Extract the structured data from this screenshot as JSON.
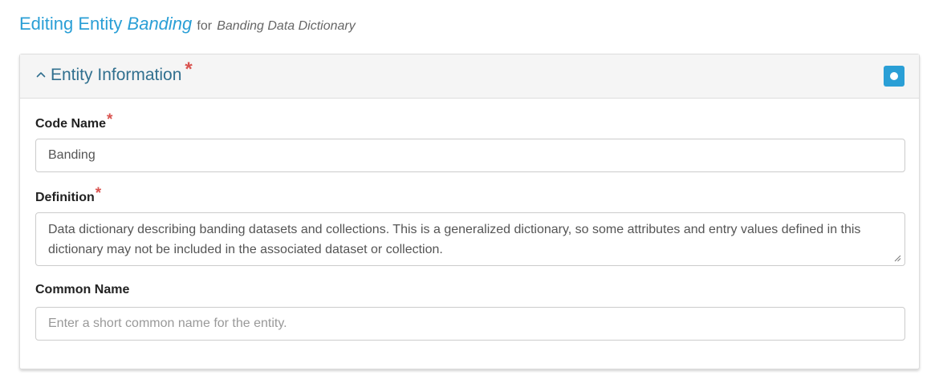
{
  "page": {
    "title_prefix": "Editing Entity",
    "entity_name": "Banding",
    "for_text": "for",
    "dictionary_name": "Banding Data Dictionary"
  },
  "panel": {
    "title": "Entity Information",
    "required_marker": "*",
    "collapse_icon": "chevron-up-icon",
    "toggle_icon": "circle-icon",
    "accent_color": "#2a9fd6"
  },
  "fields": {
    "code_name": {
      "label": "Code Name",
      "required_marker": "*",
      "value": "Banding"
    },
    "definition": {
      "label": "Definition",
      "required_marker": "*",
      "value": "Data dictionary describing banding datasets and collections. This is a generalized dictionary, so some attributes and entry values defined in this dictionary may not be included in the associated dataset or collection."
    },
    "common_name": {
      "label": "Common Name",
      "value": "",
      "placeholder": "Enter a short common name for the entity."
    }
  }
}
